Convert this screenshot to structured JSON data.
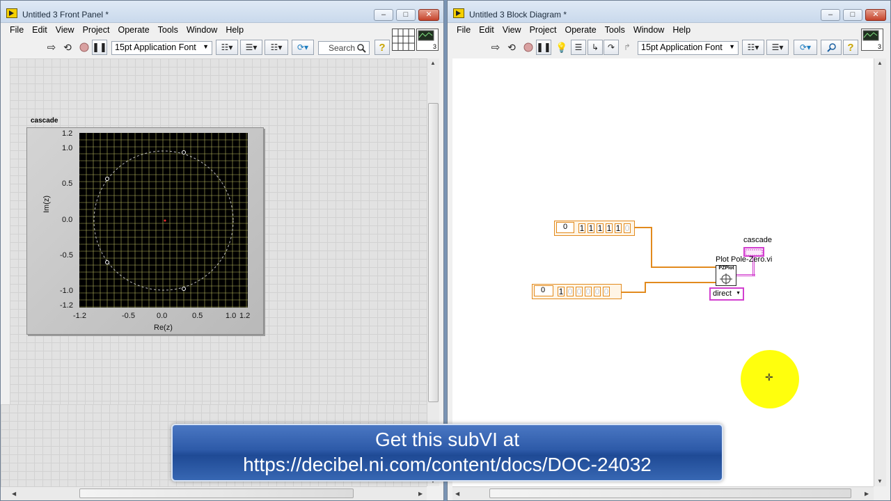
{
  "front_panel": {
    "title": "Untitled 3 Front Panel *",
    "menu": [
      "File",
      "Edit",
      "View",
      "Project",
      "Operate",
      "Tools",
      "Window",
      "Help"
    ],
    "font_selector": "15pt Application Font",
    "search_placeholder": "Search",
    "graph": {
      "label": "cascade",
      "xlabel": "Re(z)",
      "ylabel": "Im(z)",
      "x_ticks": [
        "-1.2",
        "-0.5",
        "0.0",
        "0.5",
        "1.0",
        "1.2"
      ],
      "y_ticks": [
        "1.2",
        "1.0",
        "0.5",
        "0.0",
        "-0.5",
        "-1.0",
        "-1.2"
      ],
      "background_color": "#000000",
      "grid_color": "#c9c96a"
    }
  },
  "block_diagram": {
    "title": "Untitled 3 Block Diagram *",
    "menu": [
      "File",
      "Edit",
      "View",
      "Project",
      "Operate",
      "Tools",
      "Window",
      "Help"
    ],
    "font_selector": "15pt Application Font",
    "top_array": {
      "index": "0",
      "values": [
        "1",
        "1",
        "1",
        "1",
        "1",
        "0"
      ]
    },
    "bottom_array": {
      "index": "0",
      "values": [
        "1",
        "0",
        "0",
        "0",
        "0",
        "0"
      ]
    },
    "subvi_label": "Plot Pole-Zero.vi",
    "subvi_icon_text": "PZPlot",
    "indicator_label": "cascade",
    "enum_value": "direct",
    "wire_color": "#e28a1d",
    "cluster_wire_color": "#d23fcf"
  },
  "banner": {
    "line1": "Get this subVI at",
    "line2": "https://decibel.ni.com/content/docs/DOC-24032"
  }
}
